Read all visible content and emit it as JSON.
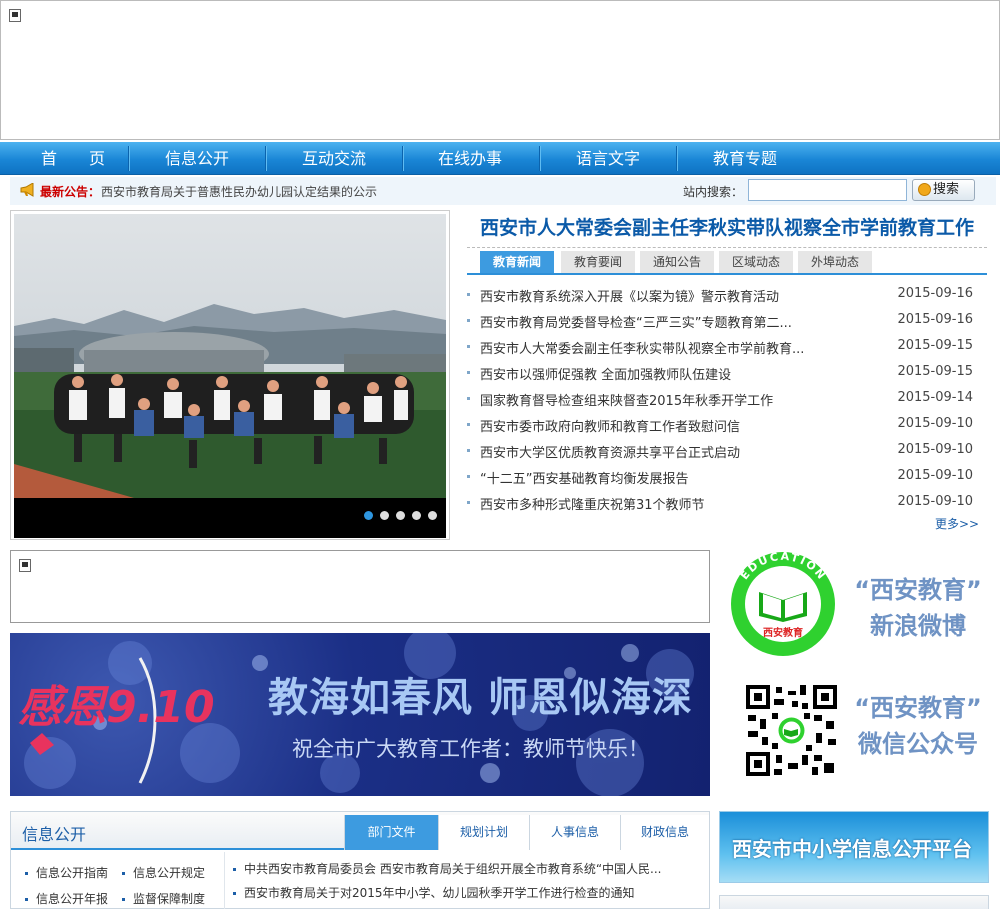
{
  "nav": {
    "items": [
      {
        "label": "首　　页"
      },
      {
        "label": "信息公开"
      },
      {
        "label": "互动交流"
      },
      {
        "label": "在线办事"
      },
      {
        "label": "语言文字"
      },
      {
        "label": "教育专题"
      }
    ]
  },
  "notice": {
    "label": "最新公告：",
    "text": "西安市教育局关于普惠性民办幼儿园认定结果的公示"
  },
  "search": {
    "label": "站内搜索：",
    "value": "",
    "button_label": "搜索"
  },
  "slideshow": {
    "dots": 5,
    "active_index": 0
  },
  "news": {
    "headline": "西安市人大常委会副主任李秋实带队视察全市学前教育工作",
    "tabs": [
      {
        "label": "教育新闻",
        "active": true
      },
      {
        "label": "教育要闻",
        "active": false
      },
      {
        "label": "通知公告",
        "active": false
      },
      {
        "label": "区域动态",
        "active": false
      },
      {
        "label": "外埠动态",
        "active": false
      }
    ],
    "items": [
      {
        "title": "西安市教育系统深入开展《以案为镜》警示教育活动",
        "date": "2015-09-16"
      },
      {
        "title": "西安市教育局党委督导检查“三严三实”专题教育第二...",
        "date": "2015-09-16"
      },
      {
        "title": "西安市人大常委会副主任李秋实带队视察全市学前教育...",
        "date": "2015-09-15"
      },
      {
        "title": "西安市以强师促强教 全面加强教师队伍建设",
        "date": "2015-09-15"
      },
      {
        "title": "国家教育督导检查组来陕督查2015年秋季开学工作",
        "date": "2015-09-14"
      },
      {
        "title": "西安市委市政府向教师和教育工作者致慰问信",
        "date": "2015-09-10"
      },
      {
        "title": "西安市大学区优质教育资源共享平台正式启动",
        "date": "2015-09-10"
      },
      {
        "title": "“十二五”西安基础教育均衡发展报告",
        "date": "2015-09-10"
      },
      {
        "title": "西安市多种形式隆重庆祝第31个教师节",
        "date": "2015-09-10"
      }
    ],
    "more_label": "更多>>"
  },
  "teacher_day_banner": {
    "logo_text": "感恩9.10",
    "main": "教海如春风 师恩似海深",
    "sub": "祝全市广大教育工作者：教师节快乐！"
  },
  "social": {
    "edu_logo_ring_text": "EDUCATION",
    "edu_logo_label": "西安教育",
    "weibo_line1": "“西安教育”",
    "weibo_line2": "新浪微博",
    "wechat_line1": "“西安教育”",
    "wechat_line2": "微信公众号"
  },
  "info_public": {
    "title": "信息公开",
    "tabs": [
      {
        "label": "部门文件",
        "active": true
      },
      {
        "label": "规划计划",
        "active": false
      },
      {
        "label": "人事信息",
        "active": false
      },
      {
        "label": "财政信息",
        "active": false
      }
    ],
    "left_links": [
      "信息公开指南",
      "信息公开规定",
      "信息公开年报",
      "监督保障制度"
    ],
    "docs": [
      "中共西安市教育局委员会 西安市教育局关于组织开展全市教育系统“中国人民...",
      "西安市教育局关于对2015年中小学、幼儿园秋季开学工作进行检查的通知"
    ]
  },
  "platform_banner": {
    "label": "西安市中小学信息公开平台"
  },
  "colors": {
    "nav_blue": "#1a86d6",
    "accent_blue": "#2d8fd8",
    "headline_blue": "#0b5aa8",
    "notice_red": "#cc0000"
  }
}
